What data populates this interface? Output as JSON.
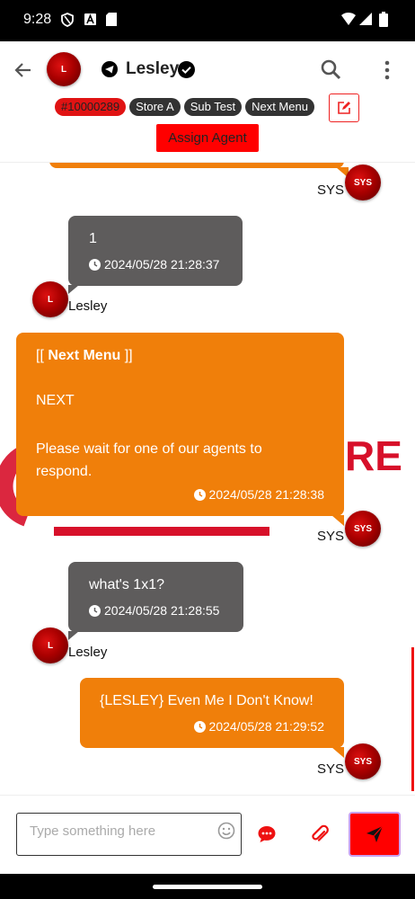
{
  "status_bar": {
    "time": "9:28"
  },
  "header": {
    "avatar_initial": "L",
    "title": "Lesley",
    "tags": [
      "#10000289",
      "Store A",
      "Sub Test",
      "Next Menu"
    ],
    "assign_label": "Assign Agent"
  },
  "watermark": {
    "text": "RE"
  },
  "messages": [
    {
      "sender": "SYS",
      "avatar": "SYS"
    },
    {
      "text": "1",
      "time": "2024/05/28 21:28:37",
      "sender": "Lesley",
      "avatar": "L"
    },
    {
      "line1_pre": "[[ ",
      "line1_bold": "Next Menu",
      "line1_post": " ]]",
      "line2": "NEXT",
      "line3": "Please wait for one of our agents to respond.",
      "time": "2024/05/28 21:28:38",
      "sender": "SYS",
      "avatar": "SYS"
    },
    {
      "text": "what's 1x1?",
      "time": "2024/05/28 21:28:55",
      "sender": "Lesley",
      "avatar": "L"
    },
    {
      "text": "{LESLEY} Even Me I Don't Know!",
      "time": "2024/05/28 21:29:52",
      "sender": "SYS",
      "avatar": "SYS"
    }
  ],
  "composer": {
    "placeholder": "Type something here"
  },
  "colors": {
    "accent": "#f07f0a",
    "incoming": "#5e5c5c",
    "brand_red": "#ff0000"
  },
  "icons": [
    "back-arrow-icon",
    "telegram-icon",
    "verified-icon",
    "search-icon",
    "more-vert-icon",
    "edit-icon",
    "clock-icon",
    "emoji-icon",
    "chat-bubble-icon",
    "paperclip-icon",
    "send-icon"
  ]
}
